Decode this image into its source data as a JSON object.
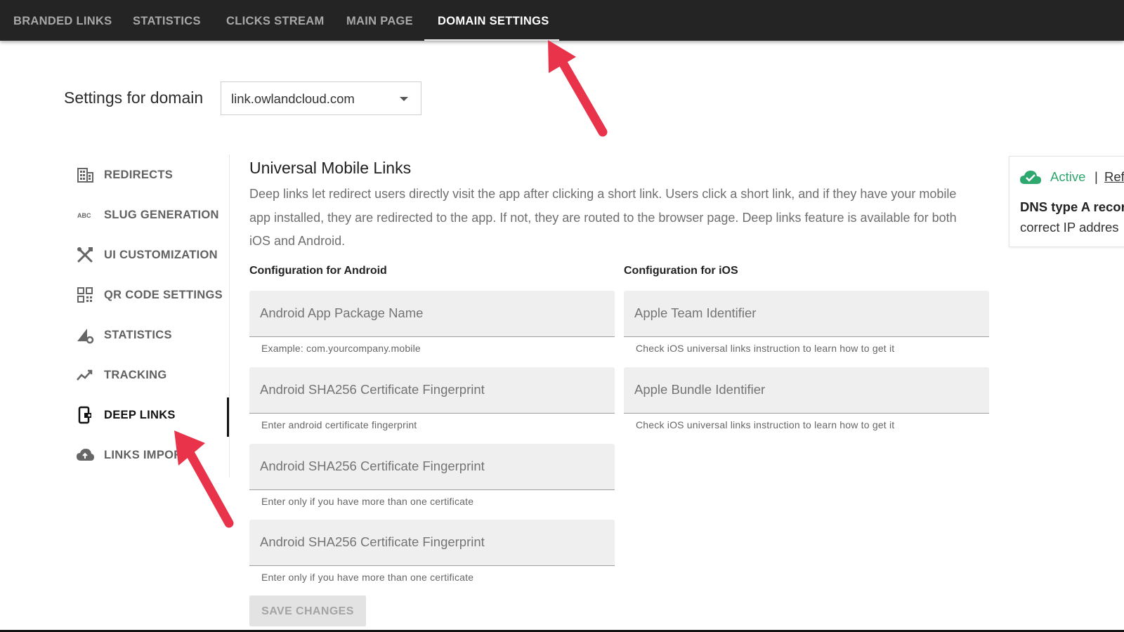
{
  "topnav": {
    "tabs": [
      {
        "label": "BRANDED LINKS"
      },
      {
        "label": "STATISTICS"
      },
      {
        "label": "CLICKS STREAM"
      },
      {
        "label": "MAIN PAGE"
      },
      {
        "label": "DOMAIN SETTINGS",
        "active": true
      }
    ]
  },
  "domain": {
    "label": "Settings for domain",
    "selected": "link.owlandcloud.com"
  },
  "sidebar": {
    "items": [
      {
        "label": "REDIRECTS",
        "icon": "building-icon"
      },
      {
        "label": "SLUG GENERATION",
        "icon": "abc-icon"
      },
      {
        "label": "UI CUSTOMIZATION",
        "icon": "tools-icon"
      },
      {
        "label": "QR CODE SETTINGS",
        "icon": "qr-code-icon"
      },
      {
        "label": "STATISTICS",
        "icon": "chart-gear-icon"
      },
      {
        "label": "TRACKING",
        "icon": "trending-icon"
      },
      {
        "label": "DEEP LINKS",
        "icon": "phone-link-icon",
        "active": true
      },
      {
        "label": "LINKS IMPOR",
        "icon": "cloud-upload-icon"
      }
    ]
  },
  "main": {
    "title": "Universal Mobile Links",
    "description": "Deep links let redirect users directly visit the app after clicking a short link. Users click a short link, and if they have your mobile app installed, they are redirected to the app. If not, they are routed to the browser page. Deep links feature is available for both iOS and Android.",
    "android": {
      "heading": "Configuration for Android",
      "fields": [
        {
          "placeholder": "Android App Package Name",
          "helper": "Example: com.yourcompany.mobile"
        },
        {
          "placeholder": "Android SHA256 Certificate Fingerprint",
          "helper": "Enter android certificate fingerprint"
        },
        {
          "placeholder": "Android SHA256 Certificate Fingerprint",
          "helper": "Enter only if you have more than one certificate"
        },
        {
          "placeholder": "Android SHA256 Certificate Fingerprint",
          "helper": "Enter only if you have more than one certificate"
        }
      ]
    },
    "ios": {
      "heading": "Configuration for iOS",
      "fields": [
        {
          "placeholder": "Apple Team Identifier",
          "helper": "Check iOS universal links instruction to learn how to get it"
        },
        {
          "placeholder": "Apple Bundle Identifier",
          "helper": "Check iOS universal links instruction to learn how to get it"
        }
      ]
    },
    "save_label": "SAVE CHANGES"
  },
  "status_card": {
    "status": "Active",
    "separator": "|",
    "refresh_label": "Ref",
    "dns_text": "DNS type A recor",
    "ip_text": "correct IP addres",
    "status_color": "#2fa870"
  },
  "annotations": {
    "arrow_color": "#e8334a"
  }
}
